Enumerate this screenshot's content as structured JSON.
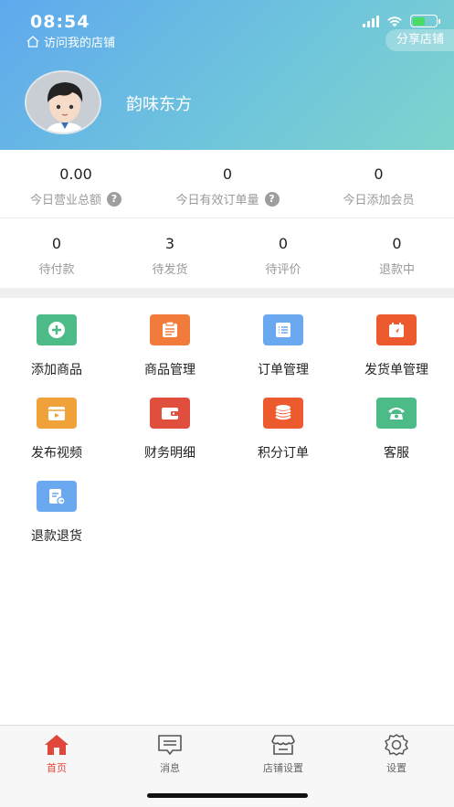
{
  "status_bar": {
    "time": "08:54"
  },
  "header": {
    "visit_store_label": "访问我的店铺",
    "share_store_label": "分享店铺",
    "store_name": "韵味东方"
  },
  "stats_top": [
    {
      "value": "0.00",
      "label": "今日营业总额",
      "help": "?"
    },
    {
      "value": "0",
      "label": "今日有效订单量",
      "help": "?"
    },
    {
      "value": "0",
      "label": "今日添加会员"
    }
  ],
  "stats_orders": [
    {
      "value": "0",
      "label": "待付款"
    },
    {
      "value": "3",
      "label": "待发货"
    },
    {
      "value": "0",
      "label": "待评价"
    },
    {
      "value": "0",
      "label": "退款中"
    }
  ],
  "menu": [
    {
      "label": "添加商品",
      "icon": "add-product-icon",
      "color": "#4cbb87"
    },
    {
      "label": "商品管理",
      "icon": "product-manage-icon",
      "color": "#f07b3a"
    },
    {
      "label": "订单管理",
      "icon": "order-list-icon",
      "color": "#6aa8f0"
    },
    {
      "label": "发货单管理",
      "icon": "shipping-icon",
      "color": "#ec5a2e"
    },
    {
      "label": "发布视频",
      "icon": "video-icon",
      "color": "#f0a13a"
    },
    {
      "label": "财务明细",
      "icon": "wallet-icon",
      "color": "#e04f3e"
    },
    {
      "label": "积分订单",
      "icon": "points-icon",
      "color": "#ec5a2e"
    },
    {
      "label": "客服",
      "icon": "phone-icon",
      "color": "#4cbb87"
    },
    {
      "label": "退款退货",
      "icon": "refund-icon",
      "color": "#6aa8f0"
    }
  ],
  "tabs": [
    {
      "label": "首页",
      "icon": "home-icon",
      "active": true
    },
    {
      "label": "消息",
      "icon": "message-icon"
    },
    {
      "label": "店铺设置",
      "icon": "store-icon"
    },
    {
      "label": "设置",
      "icon": "gear-icon"
    }
  ],
  "colors": {
    "accent": "#e0463c",
    "header_start": "#5fa8ee",
    "header_end": "#7fd3cc"
  }
}
